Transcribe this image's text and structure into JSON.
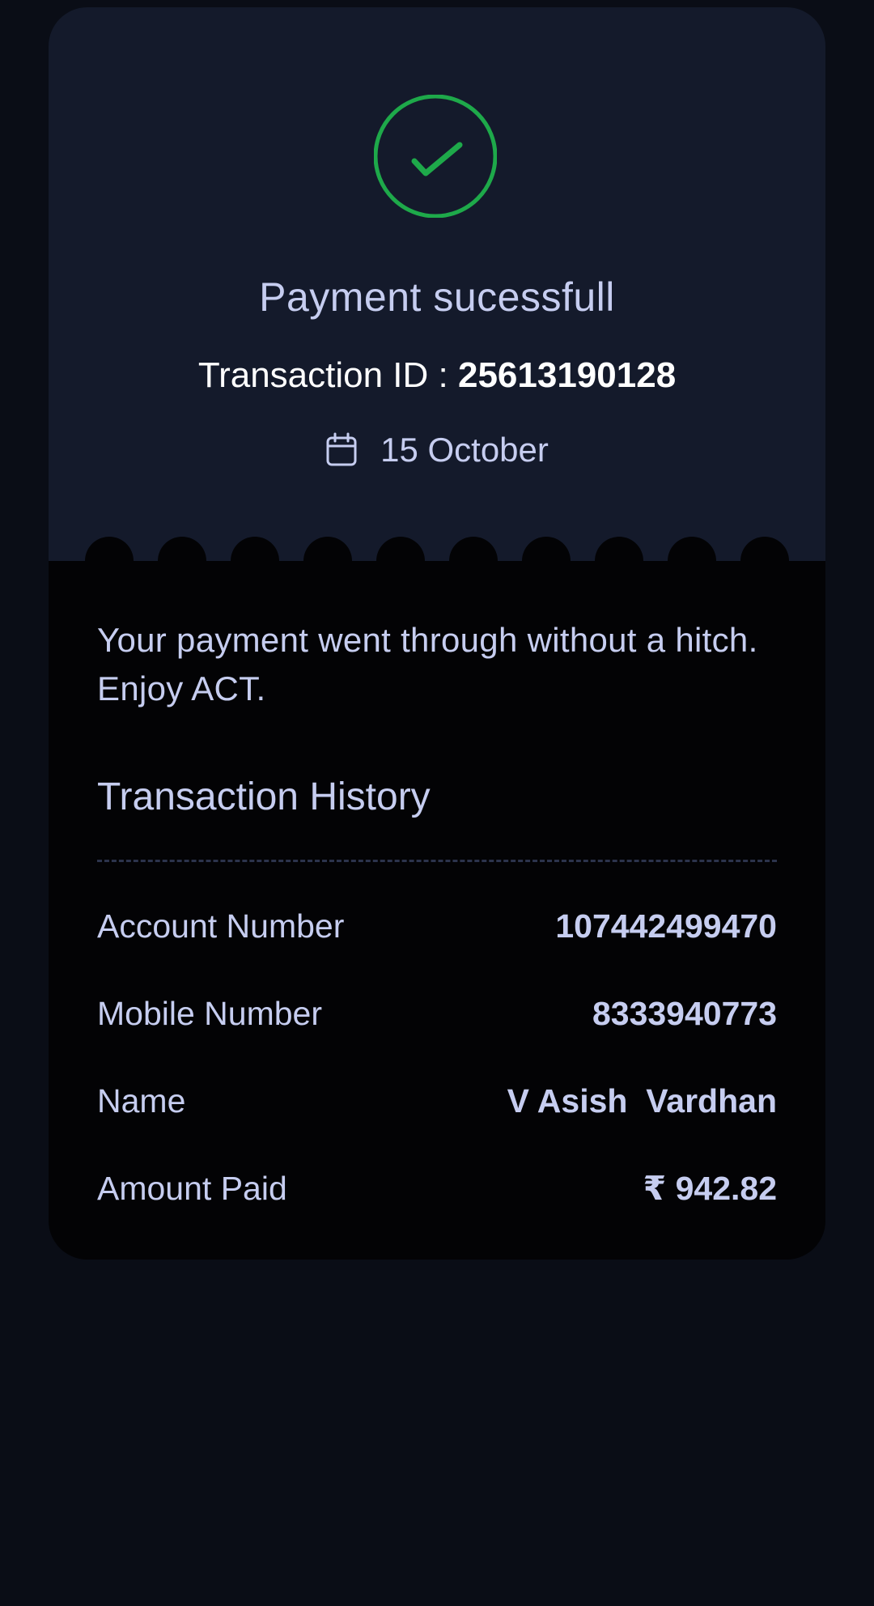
{
  "status": {
    "title": "Payment sucessfull",
    "icon": "check-circle-icon",
    "icon_color": "#1ea94a"
  },
  "transaction": {
    "id_label": "Transaction ID : ",
    "id_value": "25613190128",
    "date": "15 October",
    "date_icon": "calendar-icon"
  },
  "message": "Your payment went through without a hitch. Enjoy ACT.",
  "history": {
    "title": "Transaction History",
    "rows": [
      {
        "label": "Account Number",
        "value": "107442499470"
      },
      {
        "label": "Mobile Number",
        "value": "8333940773"
      },
      {
        "label": "Name",
        "value": "V Asish  Vardhan"
      },
      {
        "label": "Amount Paid",
        "value": "₹ 942.82"
      }
    ]
  },
  "colors": {
    "page_background": "#0a0d16",
    "card_top": "#141a2b",
    "card_bottom": "#030305",
    "text": "#c6cdf0",
    "success": "#1ea94a"
  }
}
